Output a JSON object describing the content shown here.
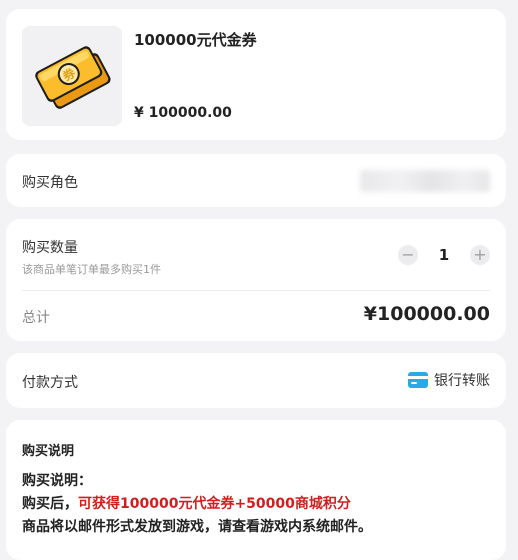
{
  "product": {
    "title": "100000元代金券",
    "price": "¥ 100000.00",
    "thumbnail_icon": "gold-voucher-ticket-icon"
  },
  "role": {
    "label": "购买角色",
    "value_redacted": true
  },
  "quantity": {
    "label": "购买数量",
    "hint": "该商品单笔订单最多购买1件",
    "value": "1",
    "minus": "−",
    "plus": "+"
  },
  "total": {
    "label": "总计",
    "value": "¥100000.00"
  },
  "payment": {
    "label": "付款方式",
    "method": "银行转账",
    "icon": "bank-card-icon"
  },
  "description": {
    "title": "购买说明",
    "line1": "购买说明：",
    "line2_prefix": "购买后，",
    "line2_highlight": "可获得100000元代金券+50000商城积分",
    "line3": "商品将以邮件形式发放到游戏，请查看游戏内系统邮件。"
  },
  "colors": {
    "background": "#f3f3f5",
    "highlight_red": "#d01f1f",
    "pay_icon_blue": "#29a9e8"
  }
}
